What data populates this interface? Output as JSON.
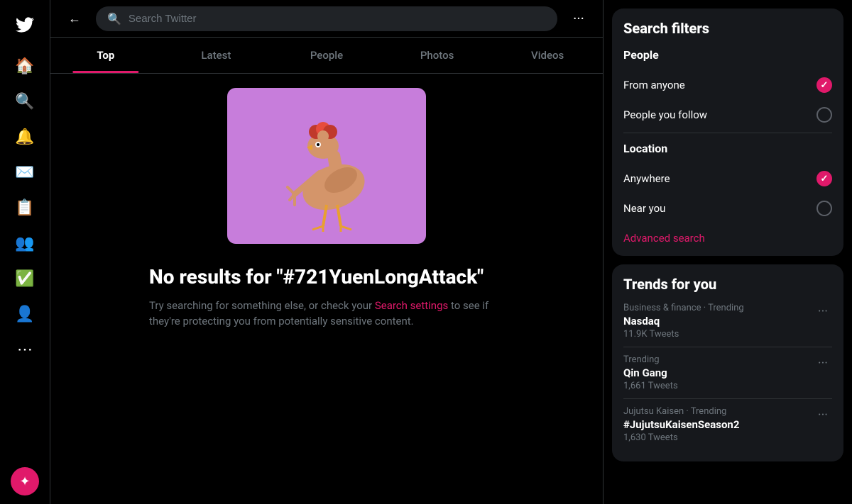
{
  "sidebar": {
    "logo": "🐦",
    "icons": [
      {
        "name": "home-icon",
        "symbol": "🏠"
      },
      {
        "name": "search-icon",
        "symbol": "🔍"
      },
      {
        "name": "notifications-icon",
        "symbol": "🔔"
      },
      {
        "name": "messages-icon",
        "symbol": "✉"
      },
      {
        "name": "bookmarks-icon",
        "symbol": "📋"
      },
      {
        "name": "communities-icon",
        "symbol": "👥"
      },
      {
        "name": "verified-icon",
        "symbol": "✅"
      },
      {
        "name": "profile-icon",
        "symbol": "👤"
      },
      {
        "name": "more-icon",
        "symbol": "⋯"
      }
    ],
    "avatar_symbol": "✦"
  },
  "header": {
    "search_placeholder": "Search Twitter",
    "search_value": "#721YuenLongAttack"
  },
  "tabs": [
    {
      "label": "Top",
      "active": true
    },
    {
      "label": "Latest",
      "active": false
    },
    {
      "label": "People",
      "active": false
    },
    {
      "label": "Photos",
      "active": false
    },
    {
      "label": "Videos",
      "active": false
    }
  ],
  "no_results": {
    "title": "No results for \"#721YuenLongAttack\"",
    "description": "Try searching for something else, or check your",
    "link_text": "Search settings",
    "description_suffix": " to see if they're protecting you from potentially sensitive content."
  },
  "search_filters": {
    "title": "Search filters",
    "people_section": "People",
    "options_people": [
      {
        "label": "From anyone",
        "checked": true
      },
      {
        "label": "People you follow",
        "checked": false
      }
    ],
    "location_section": "Location",
    "options_location": [
      {
        "label": "Anywhere",
        "checked": true
      },
      {
        "label": "Near you",
        "checked": false
      }
    ],
    "advanced_link": "Advanced search"
  },
  "trends": {
    "title": "Trends for you",
    "items": [
      {
        "category": "Business & finance · Trending",
        "name": "Nasdaq",
        "count": "11.9K Tweets"
      },
      {
        "category": "Trending",
        "name": "Qin Gang",
        "count": "1,661 Tweets"
      },
      {
        "category": "Jujutsu Kaisen · Trending",
        "name": "#JujutsuKaisenSeason2",
        "count": "1,630 Tweets"
      }
    ]
  }
}
